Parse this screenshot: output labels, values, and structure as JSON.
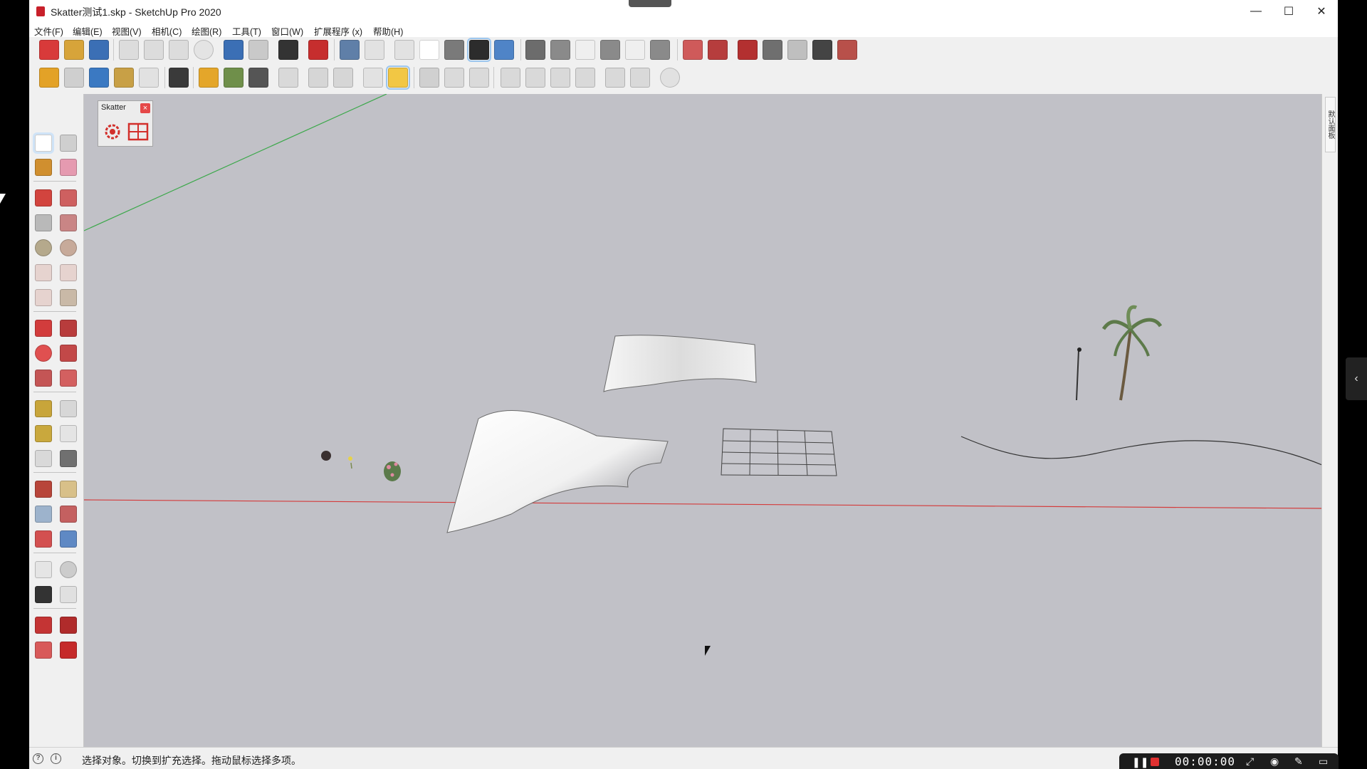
{
  "window": {
    "title": "Skatter测试1.skp - SketchUp Pro 2020",
    "minimize_glyph": "—",
    "maximize_glyph": "☐",
    "close_glyph": "✕"
  },
  "menubar": {
    "items": [
      "文件(F)",
      "编辑(E)",
      "视图(V)",
      "相机(C)",
      "绘图(R)",
      "工具(T)",
      "窗口(W)",
      "扩展程序 (x)",
      "帮助(H)"
    ]
  },
  "skatter_panel": {
    "title": "Skatter",
    "close_glyph": "×",
    "icons": [
      "skatter-gear-icon",
      "skatter-grid-icon"
    ]
  },
  "right_tray": {
    "tab_label": "默认面板"
  },
  "status": {
    "text": "选择对象。切换到扩充选择。拖动鼠标选择多项。",
    "info_glyph": "i",
    "help_glyph": "?"
  },
  "recorder": {
    "time": "00:00:00",
    "pause_glyph": "❚❚"
  },
  "colors": {
    "viewport_bg": "#c1c1c7",
    "red_axis": "#d43b3b",
    "green_axis": "#3ba84a",
    "accent_active": "#cfe3f7"
  }
}
